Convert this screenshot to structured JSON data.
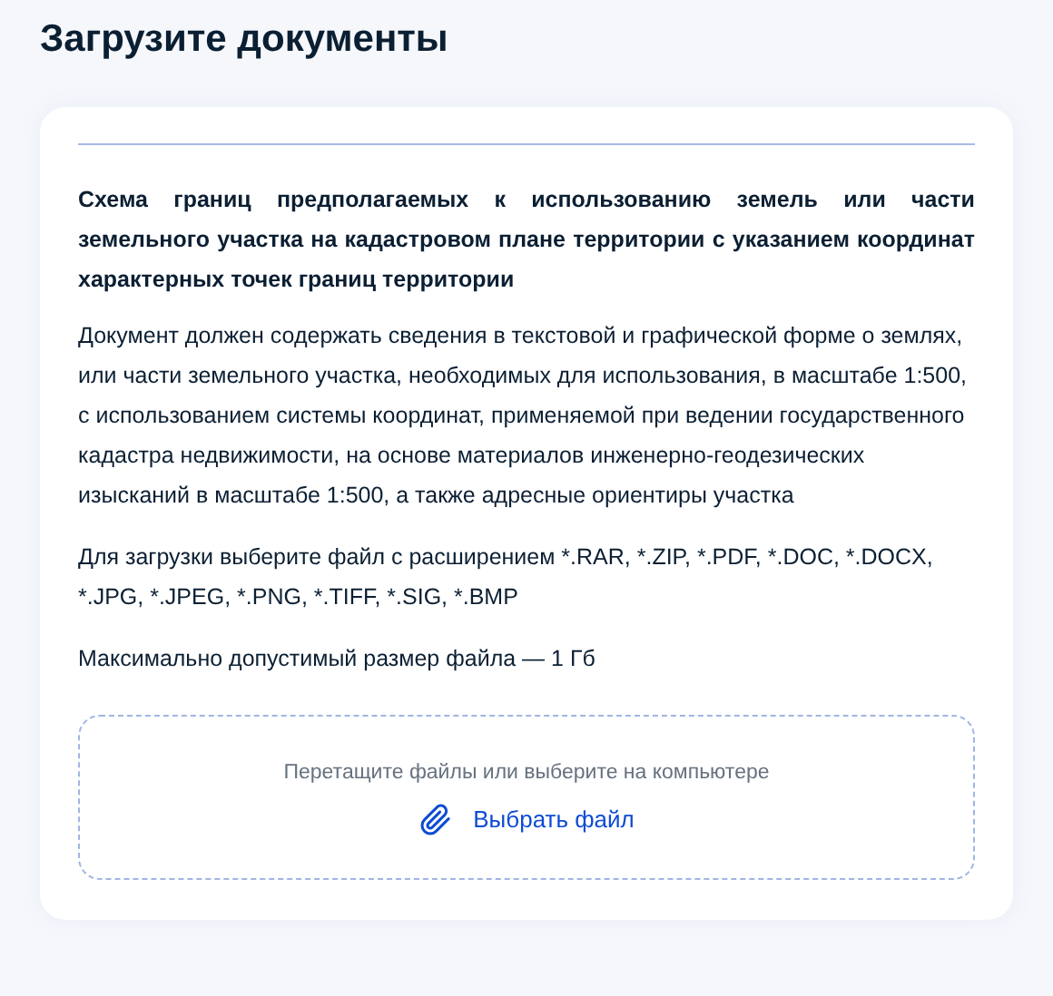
{
  "title": "Загрузите документы",
  "document": {
    "name": "Схема границ предполагаемых к использованию земель или части земельного участка на кадастровом плане территории с указанием координат характерных точек границ территории",
    "description": "Документ должен содержать сведения в текстовой и графической форме о землях, или части земельного участка, необходимых для использования, в масштабе 1:500, с использованием системы координат, применяемой при ведении государственного кадастра недвижимости, на основе материалов инженерно-геодезических изысканий в масштабе 1:500, а также адресные ориентиры участка",
    "formats": "Для загрузки выберите файл с расширением *.RAR, *.ZIP, *.PDF, *.DOC, *.DOCX, *.JPG, *.JPEG, *.PNG, *.TIFF, *.SIG, *.BMP",
    "max_size": "Максимально допустимый размер файла — 1 Гб"
  },
  "dropzone": {
    "hint": "Перетащите файлы или выберите на компьютере",
    "button": "Выбрать файл"
  }
}
